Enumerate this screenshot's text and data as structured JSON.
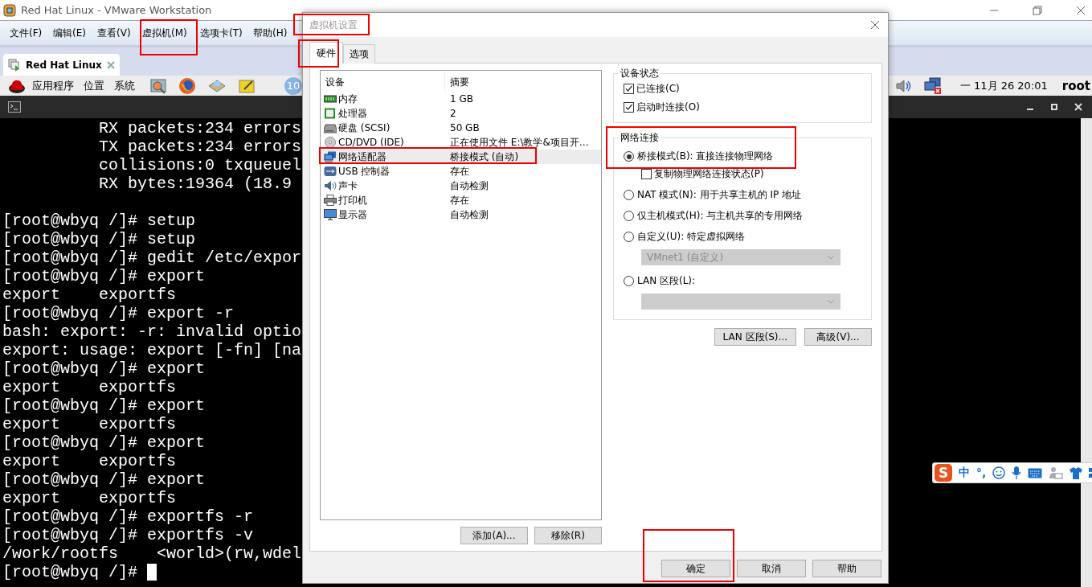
{
  "window": {
    "title": "Red Hat Linux - VMware Workstation"
  },
  "menu": [
    "文件(F)",
    "编辑(E)",
    "查看(V)",
    "虚拟机(M)",
    "选项卡(T)",
    "帮助(H)"
  ],
  "vm_tabs": [
    {
      "label": "Red Hat Linux",
      "selected": true
    }
  ],
  "panel": {
    "menus": [
      "应用程序",
      "位置",
      "系统"
    ],
    "badge": "10",
    "clock": "一 11月 26 20:01",
    "user": "root"
  },
  "terminal": {
    "blocks": [
      {
        "lines": [
          "          RX packets:234 errors",
          "          TX packets:234 errors",
          "          collisions:0 txqueuel",
          "          RX bytes:19364 (18.9"
        ]
      },
      {
        "lines": [
          "[root@wbyq /]# setup",
          "[root@wbyq /]# setup",
          "[root@wbyq /]# gedit /etc/expor",
          "[root@wbyq /]# export",
          "export    exportfs",
          "[root@wbyq /]# export -r",
          "bash: export: -r: invalid optio",
          "export: usage: export [-fn] [na",
          "[root@wbyq /]# export",
          "export    exportfs",
          "[root@wbyq /]# export",
          "export    exportfs",
          "[root@wbyq /]# export",
          "export    exportfs",
          "[root@wbyq /]# export",
          "export    exportfs",
          "[root@wbyq /]# exportfs -r",
          "[root@wbyq /]# exportfs -v",
          "/work/rootfs    <world>(rw,wdel",
          "[root@wbyq /]# "
        ]
      }
    ],
    "cursor": true
  },
  "ime": {
    "logo": "S",
    "mode": "中",
    "punct": "°,"
  },
  "dialog": {
    "title": "虚拟机设置",
    "tabs": [
      {
        "label": "硬件",
        "selected": true
      },
      {
        "label": "选项",
        "selected": false
      }
    ],
    "device_columns": [
      "设备",
      "摘要"
    ],
    "devices": [
      {
        "kind": "memory",
        "name": "内存",
        "summary": "1 GB",
        "selected": false
      },
      {
        "kind": "cpu",
        "name": "处理器",
        "summary": "2",
        "selected": false
      },
      {
        "kind": "disk",
        "name": "硬盘 (SCSI)",
        "summary": "50 GB",
        "selected": false
      },
      {
        "kind": "cd",
        "name": "CD/DVD (IDE)",
        "summary": "正在使用文件 E:\\教学&项目开…",
        "selected": false
      },
      {
        "kind": "network",
        "name": "网络适配器",
        "summary": "桥接模式 (自动)",
        "selected": true
      },
      {
        "kind": "usb",
        "name": "USB 控制器",
        "summary": "存在",
        "selected": false
      },
      {
        "kind": "sound",
        "name": "声卡",
        "summary": "自动检测",
        "selected": false
      },
      {
        "kind": "printer",
        "name": "打印机",
        "summary": "存在",
        "selected": false
      },
      {
        "kind": "display",
        "name": "显示器",
        "summary": "自动检测",
        "selected": false
      }
    ],
    "list_buttons": [
      "添加(A)...",
      "移除(R)"
    ],
    "device_status": {
      "title": "设备状态",
      "options": [
        {
          "label": "已连接(C)",
          "checked": true
        },
        {
          "label": "启动时连接(O)",
          "checked": true
        }
      ]
    },
    "network": {
      "title": "网络连接",
      "options": [
        {
          "kind": "radio",
          "label": "桥接模式(B): 直接连接物理网络",
          "selected": true
        },
        {
          "kind": "checkbox",
          "label": "复制物理网络连接状态(P)",
          "checked": false
        },
        {
          "kind": "radio",
          "label": "NAT 模式(N): 用于共享主机的 IP 地址",
          "selected": false
        },
        {
          "kind": "radio",
          "label": "仅主机模式(H): 与主机共享的专用网络",
          "selected": false
        },
        {
          "kind": "radio",
          "label": "自定义(U): 特定虚拟网络",
          "selected": false
        },
        {
          "kind": "dropdown",
          "value": "VMnet1 (自定义)",
          "disabled": true
        },
        {
          "kind": "radio",
          "label": "LAN 区段(L):",
          "selected": false
        },
        {
          "kind": "dropdown",
          "disabled": true
        }
      ]
    },
    "network_buttons": [
      "LAN 区段(S)...",
      "高级(V)..."
    ],
    "buttons": [
      "确定",
      "取消",
      "帮助"
    ]
  }
}
